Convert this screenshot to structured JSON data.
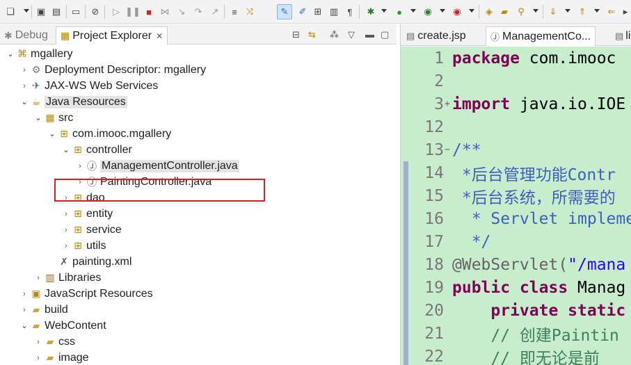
{
  "left_tabs": [
    {
      "label": "Debug",
      "active": false
    },
    {
      "label": "Project Explorer",
      "active": true
    }
  ],
  "tree": [
    {
      "label": "mgallery",
      "depth": 0,
      "arrow": "open",
      "icon": "project-icon"
    },
    {
      "label": "Deployment Descriptor: mgallery",
      "depth": 1,
      "arrow": "closed",
      "icon": "descriptor-icon"
    },
    {
      "label": "JAX-WS Web Services",
      "depth": 1,
      "arrow": "closed",
      "icon": "webservice-icon"
    },
    {
      "label": "Java Resources",
      "depth": 1,
      "arrow": "open",
      "icon": "java-resources-icon",
      "selected": true
    },
    {
      "label": "src",
      "depth": 2,
      "arrow": "open",
      "icon": "source-folder-icon"
    },
    {
      "label": "com.imooc.mgallery",
      "depth": 3,
      "arrow": "open",
      "icon": "package-icon"
    },
    {
      "label": "controller",
      "depth": 4,
      "arrow": "open",
      "icon": "package-icon"
    },
    {
      "label": "ManagementController.java",
      "depth": 5,
      "arrow": "closed",
      "icon": "java-file-icon",
      "highlighted": true
    },
    {
      "label": "PaintingController.java",
      "depth": 5,
      "arrow": "closed",
      "icon": "java-file-icon"
    },
    {
      "label": "dao",
      "depth": 4,
      "arrow": "closed",
      "icon": "package-icon"
    },
    {
      "label": "entity",
      "depth": 4,
      "arrow": "closed",
      "icon": "package-icon"
    },
    {
      "label": "service",
      "depth": 4,
      "arrow": "closed",
      "icon": "package-icon"
    },
    {
      "label": "utils",
      "depth": 4,
      "arrow": "closed",
      "icon": "package-icon"
    },
    {
      "label": "painting.xml",
      "depth": 3,
      "arrow": "none",
      "icon": "xml-file-icon"
    },
    {
      "label": "Libraries",
      "depth": 2,
      "arrow": "closed",
      "icon": "library-icon"
    },
    {
      "label": "JavaScript Resources",
      "depth": 1,
      "arrow": "closed",
      "icon": "js-resources-icon"
    },
    {
      "label": "build",
      "depth": 1,
      "arrow": "closed",
      "icon": "folder-icon"
    },
    {
      "label": "WebContent",
      "depth": 1,
      "arrow": "open",
      "icon": "folder-icon"
    },
    {
      "label": "css",
      "depth": 2,
      "arrow": "closed",
      "icon": "folder-icon"
    },
    {
      "label": "image",
      "depth": 2,
      "arrow": "closed",
      "icon": "folder-icon"
    }
  ],
  "editor_tabs": [
    {
      "label": "create.jsp",
      "active": false
    },
    {
      "label": "ManagementCo...",
      "active": true
    },
    {
      "label": "li",
      "active": false
    }
  ],
  "code_lines": [
    {
      "num": "1",
      "fold": "",
      "parts": [
        {
          "t": "package ",
          "c": "kw"
        },
        {
          "t": "com.imooc",
          "c": ""
        }
      ]
    },
    {
      "num": "2",
      "fold": "",
      "parts": []
    },
    {
      "num": "3",
      "fold": "+",
      "parts": [
        {
          "t": "import ",
          "c": "kw"
        },
        {
          "t": "java.io.IOE",
          "c": ""
        }
      ]
    },
    {
      "num": "12",
      "fold": "",
      "parts": []
    },
    {
      "num": "13",
      "fold": "−",
      "parts": [
        {
          "t": "/**",
          "c": "cm"
        }
      ]
    },
    {
      "num": "14",
      "fold": "",
      "parts": [
        {
          "t": " *后台管理功能Contr",
          "c": "cm"
        }
      ]
    },
    {
      "num": "15",
      "fold": "",
      "parts": [
        {
          "t": " *后台系统，所需要的",
          "c": "cm"
        }
      ]
    },
    {
      "num": "16",
      "fold": "",
      "parts": [
        {
          "t": "  * Servlet impleme",
          "c": "cm"
        }
      ]
    },
    {
      "num": "17",
      "fold": "",
      "parts": [
        {
          "t": "  */",
          "c": "cm"
        }
      ]
    },
    {
      "num": "18",
      "fold": "",
      "parts": [
        {
          "t": "@WebServlet(",
          "c": "an"
        },
        {
          "t": "\"/mana",
          "c": "st"
        }
      ]
    },
    {
      "num": "19",
      "fold": "",
      "parts": [
        {
          "t": "public ",
          "c": "kw"
        },
        {
          "t": "class ",
          "c": "kw"
        },
        {
          "t": "Manag",
          "c": ""
        }
      ]
    },
    {
      "num": "20",
      "fold": "",
      "parts": [
        {
          "t": "    private ",
          "c": "kw"
        },
        {
          "t": "static",
          "c": "kw"
        }
      ]
    },
    {
      "num": "21",
      "fold": "",
      "parts": [
        {
          "t": "    // 创建Paintin",
          "c": "cmg"
        }
      ]
    },
    {
      "num": "22",
      "fold": "",
      "parts": [
        {
          "t": "    // 即无论是前",
          "c": "cmg"
        }
      ]
    }
  ]
}
